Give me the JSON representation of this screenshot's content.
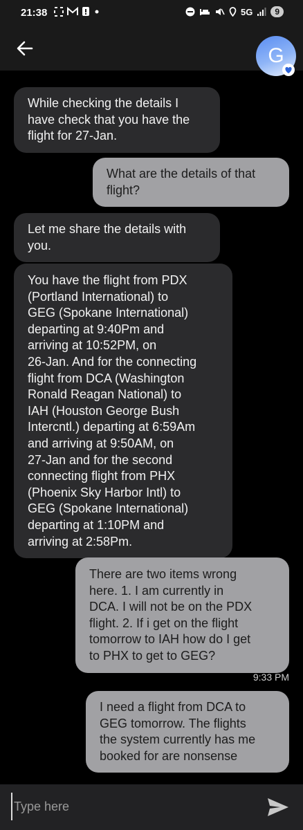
{
  "status_bar": {
    "time": "21:38",
    "network": "5G",
    "battery": "9"
  },
  "header": {
    "avatar_letter": "G"
  },
  "messages": [
    {
      "side": "in",
      "text": "While checking the details I\nhave check that you have the\nflight for 27-Jan."
    },
    {
      "side": "out",
      "text": "What are the details of that\nflight?"
    },
    {
      "side": "in",
      "text": "Let me share the details with\nyou."
    },
    {
      "side": "in",
      "text": "You have the flight from PDX\n(Portland International) to\nGEG (Spokane International)\ndeparting at 9:40Pm and\narriving at 10:52PM, on\n26-Jan. And for the connecting\nflight from DCA (Washington\nRonald Reagan National) to\nIAH (Houston George Bush\nIntercntl.) departing at 6:59Am\nand arriving at 9:50AM, on\n27-Jan and for the second\nconnecting flight from PHX\n(Phoenix Sky Harbor Intl) to\nGEG (Spokane International)\ndeparting at 1:10PM and\narriving at 2:58Pm."
    },
    {
      "side": "out",
      "text": "There are two items wrong\nhere.  1. I am currently in\nDCA.   I will not be on the PDX\nflight.  2.  If i get on the flight\ntomorrow to IAH how do I get\nto PHX to get to GEG?"
    },
    {
      "side": "out",
      "text": "I need a flight from DCA to\nGEG tomorrow.  The flights\nthe system currently has me\nbooked for are nonsense"
    }
  ],
  "timestamp": "9:33 PM",
  "composer": {
    "placeholder": "Type here"
  },
  "colors": {
    "incoming_bubble": "#2b2b2d",
    "outgoing_bubble": "#a1a1a4",
    "background": "#000000",
    "avatar": "#5a8df2"
  }
}
